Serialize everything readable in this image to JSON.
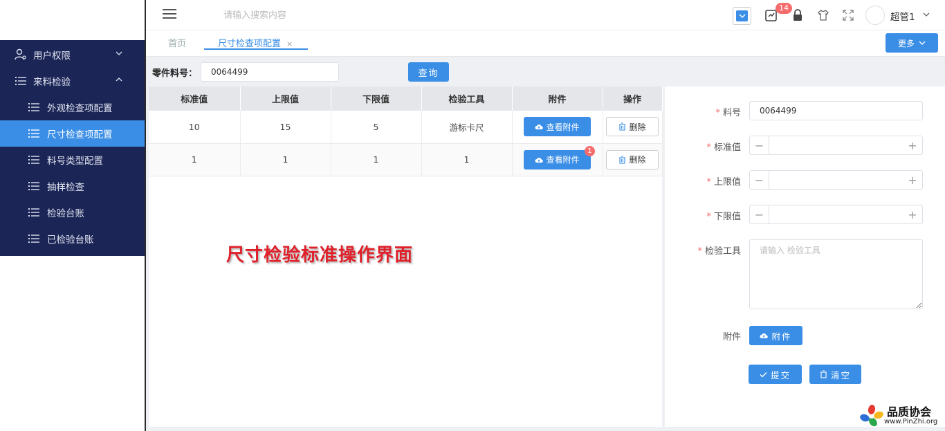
{
  "sidebar": {
    "groups": [
      {
        "label": "用户权限",
        "icon": "user-settings-icon",
        "expanded": false
      },
      {
        "label": "来料检验",
        "icon": "list-icon",
        "expanded": true
      }
    ],
    "items": [
      {
        "label": "外观检查项配置",
        "active": false
      },
      {
        "label": "尺寸检查项配置",
        "active": true
      },
      {
        "label": "料号类型配置",
        "active": false
      },
      {
        "label": "抽样检查",
        "active": false
      },
      {
        "label": "检验台账",
        "active": false
      },
      {
        "label": "已检验台账",
        "active": false
      }
    ]
  },
  "header": {
    "search_placeholder": "请输入搜索内容",
    "notification_count": "14",
    "user_name": "超管1"
  },
  "tabs": {
    "home": "首页",
    "active": "尺寸检查项配置",
    "close": "×",
    "more": "更多"
  },
  "query": {
    "label": "零件料号：",
    "value": "0064499",
    "button": "查询"
  },
  "table": {
    "columns": [
      "标准值",
      "上限值",
      "下限值",
      "检验工具",
      "附件",
      "操作"
    ],
    "rows": [
      {
        "standard": "10",
        "upper": "15",
        "lower": "5",
        "tool": "游标卡尺",
        "attach_count": ""
      },
      {
        "standard": "1",
        "upper": "1",
        "lower": "1",
        "tool": "1",
        "attach_count": "1"
      }
    ],
    "view_attach": "查看附件",
    "delete": "删除"
  },
  "overlay_title": "尺寸检验标准操作界面",
  "form": {
    "part_label": "料号",
    "part_value": "0064499",
    "standard_label": "标准值",
    "upper_label": "上限值",
    "lower_label": "下限值",
    "tool_label": "检验工具",
    "tool_placeholder": "请输入 检验工具",
    "attach_label": "附件",
    "attach_button": "附件",
    "submit_button": "提交",
    "clear_button": "清空",
    "required_mark": "*"
  },
  "watermark": {
    "name": "品质协会",
    "url": "www.PinZhi.org"
  },
  "colors": {
    "sidebar_bg": "#1b2556",
    "accent": "#3a8ee6",
    "danger": "#f56c6c",
    "overlay_red": "#e0202a"
  }
}
